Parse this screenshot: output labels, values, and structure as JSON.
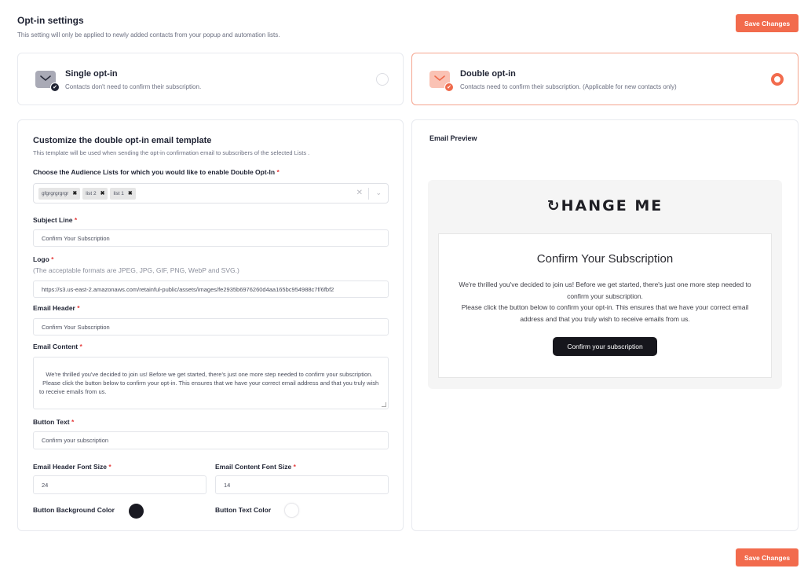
{
  "header": {
    "title": "Opt-in settings",
    "subtitle": "This setting will only be applied to newly added contacts from your popup and automation lists."
  },
  "actions": {
    "save_label": "Save Changes"
  },
  "colors": {
    "accent": "#f26b4d",
    "button_background": "#1a1a22",
    "button_text": "#ffffff"
  },
  "opt_in_options": [
    {
      "title": "Single opt-in",
      "description": "Contacts don't need to confirm their subscription.",
      "icon": "envelope-check-icon",
      "selected": false
    },
    {
      "title": "Double opt-in",
      "description": "Contacts need to confirm their subscription. (Applicable for new contacts only)",
      "icon": "envelope-double-check-icon",
      "selected": true
    }
  ],
  "form": {
    "title": "Customize the double opt-in email template",
    "subtitle": "This template will be used when sending the opt-in confirmation email to subscribers of the selected Lists .",
    "required_marker": "*",
    "audience_lists": {
      "label": "Choose the Audience Lists for which you would like to enable Double Opt-In",
      "selected": [
        "gfgrgrgrgrgr",
        "list 2",
        "list 1"
      ],
      "remove_glyph": "✖",
      "clear_glyph": "✕",
      "caret_glyph": "⌄"
    },
    "subject_line": {
      "label": "Subject Line",
      "value": "Confirm Your Subscription"
    },
    "logo": {
      "label": "Logo",
      "hint": "(The acceptable formats are JPEG, JPG, GIF, PNG, WebP and SVG.)",
      "value": "https://s3.us-east-2.amazonaws.com/retainful-public/assets/images/fe2935b6976260d4aa165bc954988c7f/6fbf2"
    },
    "email_header": {
      "label": "Email Header",
      "value": "Confirm Your Subscription"
    },
    "email_content": {
      "label": "Email Content",
      "value": "We're thrilled you've decided to join us! Before we get started, there's just one more step needed to confirm your subscription.\n  Please click the button below to confirm your opt-in. This ensures that we have your correct email address and that you truly wish to receive emails from us."
    },
    "button_text": {
      "label": "Button Text",
      "value": "Confirm your subscription"
    },
    "header_font_size": {
      "label": "Email Header Font Size",
      "value": "24"
    },
    "content_font_size": {
      "label": "Email Content Font Size",
      "value": "14"
    },
    "button_bg_color": {
      "label": "Button Background Color",
      "value": "#1a1a22"
    },
    "button_text_color": {
      "label": "Button Text Color",
      "value": "#ffffff"
    }
  },
  "preview": {
    "title": "Email Preview",
    "logo_text": "↻HANGE ME",
    "header": "Confirm Your Subscription",
    "content_line1": "We're thrilled you've decided to join us! Before we get started, there's just one more step needed to confirm your subscription.",
    "content_line2": "Please click the button below to confirm your opt-in. This ensures that we have your correct email address and that you truly wish to receive emails from us.",
    "button_label": "Confirm your subscription"
  }
}
